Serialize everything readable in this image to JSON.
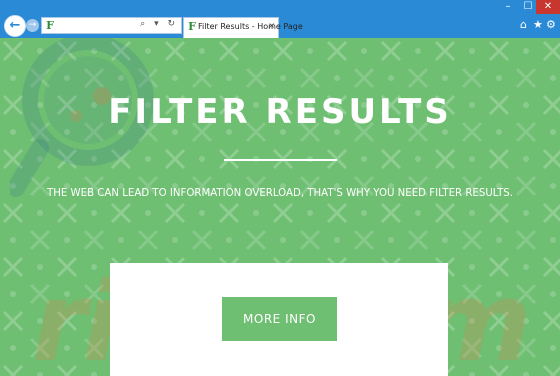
{
  "browser": {
    "window_controls": {
      "minimize": "–",
      "maximize": "☐",
      "close": "✕"
    },
    "back_glyph": "←",
    "forward_glyph": "→",
    "favicon_letter": "F",
    "address_icons": "⌕ ▾ ↻",
    "tab": {
      "title": "Filter Results - Home Page",
      "close": "×"
    },
    "tools": {
      "home": "⌂",
      "favorites": "★",
      "settings": "⚙"
    }
  },
  "page": {
    "title": "FILTER RESULTS",
    "tagline": "THE WEB CAN LEAD TO INFORMATION OVERLOAD, THAT'S WHY YOU NEED FILTER RESULTS.",
    "cta_label": "MORE INFO",
    "watermark": "risk.com"
  },
  "colors": {
    "chrome": "#2b8ad6",
    "page_green": "#6fbf73",
    "close_red": "#c7372f",
    "watermark": "#eb7846"
  }
}
